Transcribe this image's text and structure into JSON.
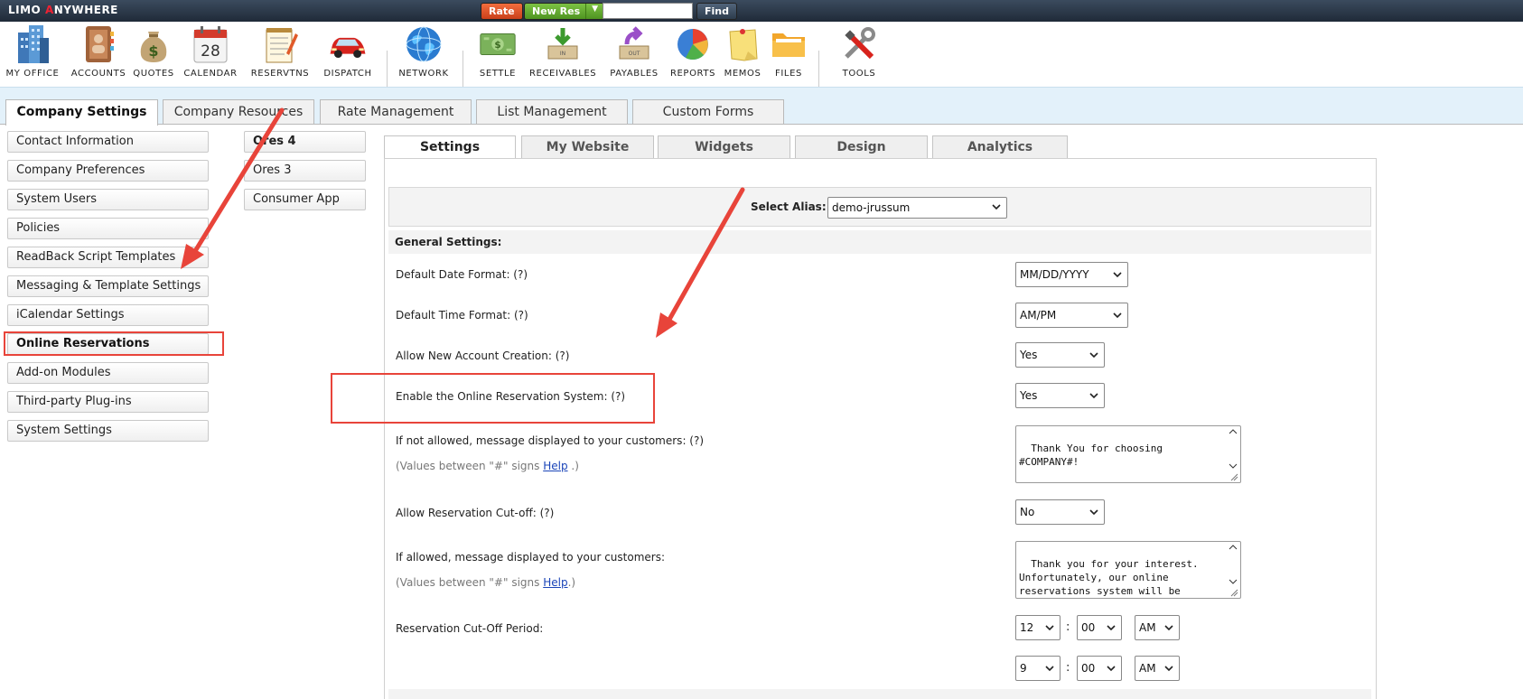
{
  "topbar": {
    "logo_main": "LIMO ",
    "logo_accent": "A",
    "logo_rest": "NYWHERE",
    "rate_label": "Rate",
    "newres_label": "New Res",
    "find_label": "Find",
    "search_value": ""
  },
  "toolbar": [
    {
      "label": "MY OFFICE",
      "icon": "office-building-icon"
    },
    {
      "label": "ACCOUNTS",
      "icon": "address-book-icon"
    },
    {
      "label": "QUOTES",
      "icon": "money-bag-icon"
    },
    {
      "label": "CALENDAR",
      "icon": "calendar-icon",
      "day": "28"
    },
    {
      "label": "RESERVTNS",
      "icon": "notepad-icon"
    },
    {
      "label": "DISPATCH",
      "icon": "car-icon"
    },
    {
      "label": "NETWORK",
      "icon": "globe-icon"
    },
    {
      "label": "SETTLE",
      "icon": "cash-icon"
    },
    {
      "label": "RECEIVABLES",
      "icon": "inbox-icon"
    },
    {
      "label": "PAYABLES",
      "icon": "outbox-icon"
    },
    {
      "label": "REPORTS",
      "icon": "pie-chart-icon"
    },
    {
      "label": "MEMOS",
      "icon": "sticky-note-icon"
    },
    {
      "label": "FILES",
      "icon": "folder-icon"
    },
    {
      "label": "TOOLS",
      "icon": "tools-icon"
    }
  ],
  "main_tabs": [
    "Company Settings",
    "Company Resources",
    "Rate Management",
    "List Management",
    "Custom Forms"
  ],
  "sidebar": [
    "Contact Information",
    "Company Preferences",
    "System Users",
    "Policies",
    "ReadBack Script Templates",
    "Messaging & Template Settings",
    "iCalendar Settings",
    "Online Reservations",
    "Add-on Modules",
    "Third-party Plug-ins",
    "System Settings"
  ],
  "subnav": [
    "Ores 4",
    "Ores 3",
    "Consumer App"
  ],
  "subtabs": [
    "Settings",
    "My Website",
    "Widgets",
    "Design",
    "Analytics"
  ],
  "alias": {
    "label": "Select Alias:",
    "value": "demo-jrussum"
  },
  "general_header": "General Settings:",
  "settings": {
    "date_format": {
      "label": "Default Date Format:  (?)",
      "value": "MM/DD/YYYY"
    },
    "time_format": {
      "label": "Default Time Format:  (?)",
      "value": "AM/PM"
    },
    "new_account": {
      "label": "Allow New Account Creation:  (?)",
      "value": "Yes"
    },
    "enable_ores": {
      "label": "Enable the Online Reservation System:  (?)",
      "value": "Yes"
    },
    "not_allowed_msg": {
      "label": "If not allowed, message displayed to your customers:  (?)",
      "hint_pre": "(Values between \"#\" signs ",
      "hint_link": "Help",
      "hint_post": " .)",
      "value": "Thank You for choosing\n#COMPANY#!"
    },
    "cutoff": {
      "label": "Allow Reservation Cut-off:  (?)",
      "value": "No"
    },
    "allowed_msg": {
      "label": "If allowed, message displayed to your customers:",
      "hint_pre": "(Values between \"#\" signs ",
      "hint_link": "Help",
      "hint_post": ".)",
      "value": "Thank you for your interest.\nUnfortunately, our online\nreservations system will be\noffline from #FROM_TIME# to"
    },
    "cutoff_period": {
      "label": "Reservation Cut-Off Period:",
      "from": {
        "hour": "12",
        "minute": "00",
        "ampm": "AM"
      },
      "to": {
        "hour": "9",
        "minute": "00",
        "ampm": "AM"
      },
      "separator": ":"
    }
  },
  "colors": {
    "annotation_red": "#e8443a",
    "band_blue": "#e3f1fa"
  }
}
